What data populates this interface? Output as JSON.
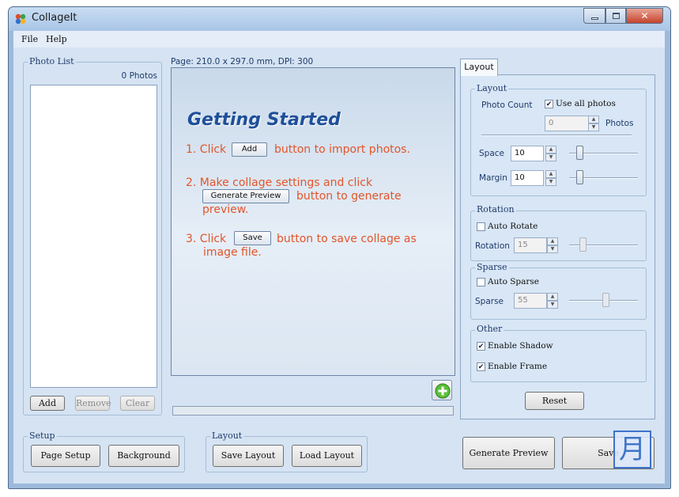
{
  "window": {
    "title": "CollageIt"
  },
  "menu": [
    {
      "label": "File"
    },
    {
      "label": "Help"
    }
  ],
  "photo_list": {
    "group_label": "Photo List",
    "count": "0 Photos",
    "buttons": {
      "add": "Add",
      "remove": "Remove",
      "clear": "Clear"
    }
  },
  "canvas": {
    "page_info": "Page: 210.0 x 297.0 mm, DPI: 300",
    "getting_started": {
      "title": "Getting Started",
      "step1_prefix": "1. Click",
      "step1_button": "Add",
      "step1_suffix": "button to import photos.",
      "step2_line1": "2. Make collage settings and click",
      "step2_button": "Generate Preview",
      "step2_suffix": "button to generate",
      "step2_line3": "preview.",
      "step3_prefix": "3. Click",
      "step3_button": "Save",
      "step3_suffix": "button to save collage as",
      "step3_line2": "image file."
    }
  },
  "layout_tab": {
    "tab_label": "Layout",
    "layout_group": {
      "label": "Layout",
      "photo_count_label": "Photo Count",
      "use_all_label": "Use all photos",
      "use_all_checked": true,
      "photo_count_value": "0",
      "photos_suffix": "Photos",
      "space_label": "Space",
      "space_value": "10",
      "margin_label": "Margin",
      "margin_value": "10"
    },
    "rotation_group": {
      "label": "Rotation",
      "auto_label": "Auto Rotate",
      "auto_checked": false,
      "rotation_label": "Rotation",
      "rotation_value": "15"
    },
    "sparse_group": {
      "label": "Sparse",
      "auto_label": "Auto Sparse",
      "auto_checked": false,
      "sparse_label": "Sparse",
      "sparse_value": "55"
    },
    "other_group": {
      "label": "Other",
      "shadow_label": "Enable Shadow",
      "shadow_checked": true,
      "frame_label": "Enable Frame",
      "frame_checked": true
    },
    "reset_label": "Reset"
  },
  "bottom": {
    "setup": {
      "label": "Setup",
      "page_setup": "Page Setup",
      "background": "Background"
    },
    "layout": {
      "label": "Layout",
      "save_layout": "Save Layout",
      "load_layout": "Load Layout"
    },
    "generate_preview": "Generate Preview",
    "save": "Save"
  },
  "overlay": {
    "glyph": "月"
  },
  "colors": {
    "step_text": "#e2552a",
    "title_text": "#1f4f9a",
    "panel_bg": "#d5e3f3"
  }
}
